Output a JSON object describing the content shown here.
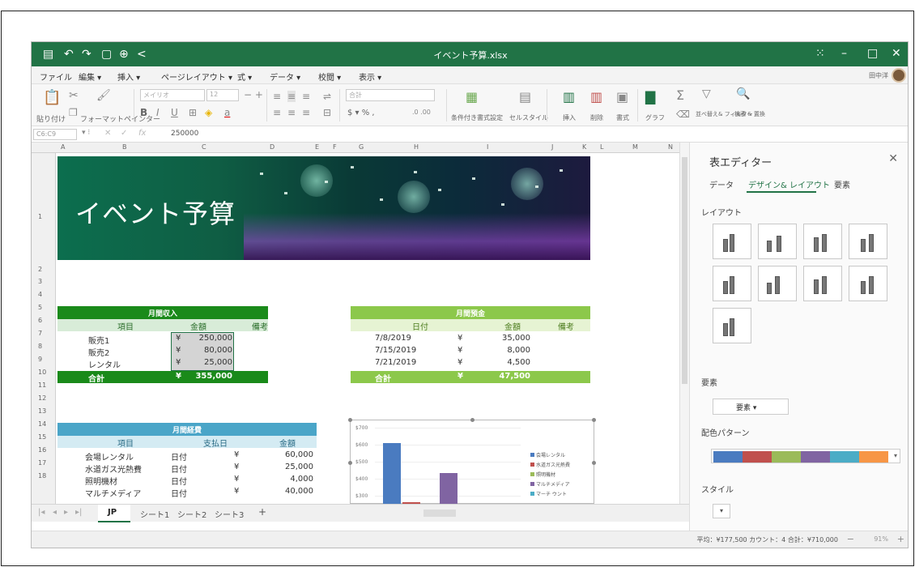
{
  "window": {
    "title": "イベント予算.xlsx",
    "accent": "#217346"
  },
  "menu": {
    "items": [
      "ファイル",
      "編集 ▾",
      "挿入 ▾",
      "ページレイアウト ▾",
      "式 ▾",
      "データ ▾",
      "校閲 ▾",
      "表示 ▾"
    ],
    "user": "田中洋"
  },
  "ribbon": {
    "paste": "貼り付け",
    "format_painter": "フォーマットペインター",
    "font": "メイリオ",
    "font_size": "12",
    "number_format": "合計",
    "currency": "$ ▾  %  ,",
    "cond_format": "条件付き書式設定",
    "cell_style": "セルスタイル",
    "insert": "挿入",
    "delete": "削除",
    "format": "書式",
    "chart": "グラフ",
    "sort_filter": "並べ替え& フィルター",
    "find_replace": "検索 & 置換"
  },
  "formula_bar": {
    "name_box": "C6:C9",
    "value": "250000"
  },
  "columns": [
    "A",
    "B",
    "C",
    "D",
    "E",
    "F",
    "G",
    "H",
    "I",
    "J",
    "K",
    "L",
    "M",
    "N"
  ],
  "rows": [
    "1",
    "2",
    "3",
    "4",
    "5",
    "6",
    "7",
    "8",
    "9",
    "10",
    "11",
    "12",
    "13",
    "14",
    "15",
    "16",
    "17",
    "18"
  ],
  "banner": {
    "title": "イベント予算"
  },
  "income": {
    "title": "月間収入",
    "headers": [
      "項目",
      "金額",
      "備考"
    ],
    "rows": [
      {
        "item": "販売1",
        "cur": "¥",
        "amount": "250,000"
      },
      {
        "item": "販売2",
        "cur": "¥",
        "amount": "80,000"
      },
      {
        "item": "レンタル",
        "cur": "¥",
        "amount": "25,000"
      }
    ],
    "total": {
      "label": "合計",
      "cur": "¥",
      "amount": "355,000"
    }
  },
  "savings": {
    "title": "月間預金",
    "headers": [
      "日付",
      "金額",
      "備考"
    ],
    "rows": [
      {
        "date": "7/8/2019",
        "cur": "¥",
        "amount": "35,000"
      },
      {
        "date": "7/15/2019",
        "cur": "¥",
        "amount": "8,000"
      },
      {
        "date": "7/21/2019",
        "cur": "¥",
        "amount": "4,500"
      }
    ],
    "total": {
      "label": "合計",
      "cur": "¥",
      "amount": "47,500"
    }
  },
  "expenses": {
    "title": "月間経費",
    "headers": [
      "項目",
      "支払日",
      "金額"
    ],
    "rows": [
      {
        "item": "会場レンタル",
        "date": "日付",
        "cur": "¥",
        "amount": "60,000"
      },
      {
        "item": "水道ガス光熱費",
        "date": "日付",
        "cur": "¥",
        "amount": "25,000"
      },
      {
        "item": "照明機材",
        "date": "日付",
        "cur": "¥",
        "amount": "4,000"
      },
      {
        "item": "マルチメディア",
        "date": "日付",
        "cur": "¥",
        "amount": "40,000"
      }
    ]
  },
  "chart_data": {
    "type": "bar",
    "title": "",
    "ylim": [
      200,
      700
    ],
    "yticks": [
      "$700",
      "$600",
      "$500",
      "$400",
      "$300"
    ],
    "series": [
      {
        "name": "会場レンタル",
        "color": "#4a7bc0",
        "values": [
          600
        ]
      },
      {
        "name": "水道ガス光熱費",
        "color": "#c0504d",
        "values": [
          210
        ]
      },
      {
        "name": "照明機材",
        "color": "#9bbb59",
        "values": [
          null
        ]
      },
      {
        "name": "マルチメディア",
        "color": "#8064a2",
        "values": [
          400
        ]
      }
    ],
    "legend_extra": "マーチ ウント"
  },
  "sheet_tabs": [
    "JP",
    "シート1",
    "シート2",
    "シート3",
    "+"
  ],
  "status": {
    "summary": "平均：¥177,500  カウント：4  合計：¥710,000",
    "zoom": "91%"
  },
  "panel": {
    "title": "表エディター",
    "tabs": [
      "データ",
      "デザイン& レイアウト",
      "要素"
    ],
    "sections": {
      "layout": "レイアウト",
      "elements": "要素",
      "palette": "配色パターン",
      "style": "スタイル"
    },
    "elements_value": "要素 ▾",
    "palette": [
      "#4a7bc0",
      "#c0504d",
      "#9bbb59",
      "#8064a2",
      "#4bacc6",
      "#f79646"
    ]
  }
}
